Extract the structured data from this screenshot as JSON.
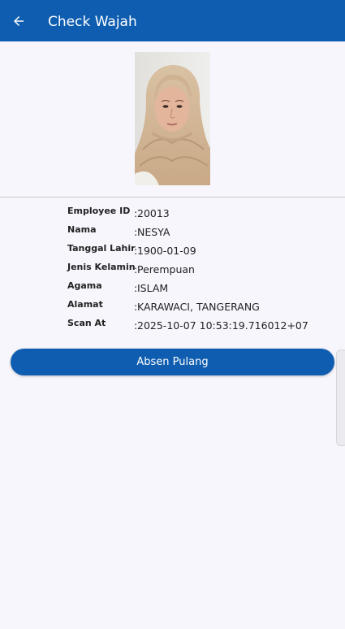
{
  "appbar": {
    "title": "Check Wajah",
    "back_icon": "arrow-left-icon",
    "color": "#0f5db0"
  },
  "photo": {
    "description_icon": "face-photo"
  },
  "employee": {
    "rows": [
      {
        "label": "Employee ID",
        "value": "20013"
      },
      {
        "label": "Nama",
        "value": "NESYA"
      },
      {
        "label": "Tanggal Lahir",
        "value": "1900-01-09"
      },
      {
        "label": "Jenis Kelamin",
        "value": "Perempuan"
      },
      {
        "label": "Agama",
        "value": "ISLAM"
      },
      {
        "label": "Alamat",
        "value": "KARAWACI, TANGERANG"
      },
      {
        "label": "Scan At",
        "value": "2025-10-07 10:53:19.716012+07"
      }
    ],
    "separator": ":"
  },
  "actions": {
    "absen_label": "Absen Pulang"
  }
}
